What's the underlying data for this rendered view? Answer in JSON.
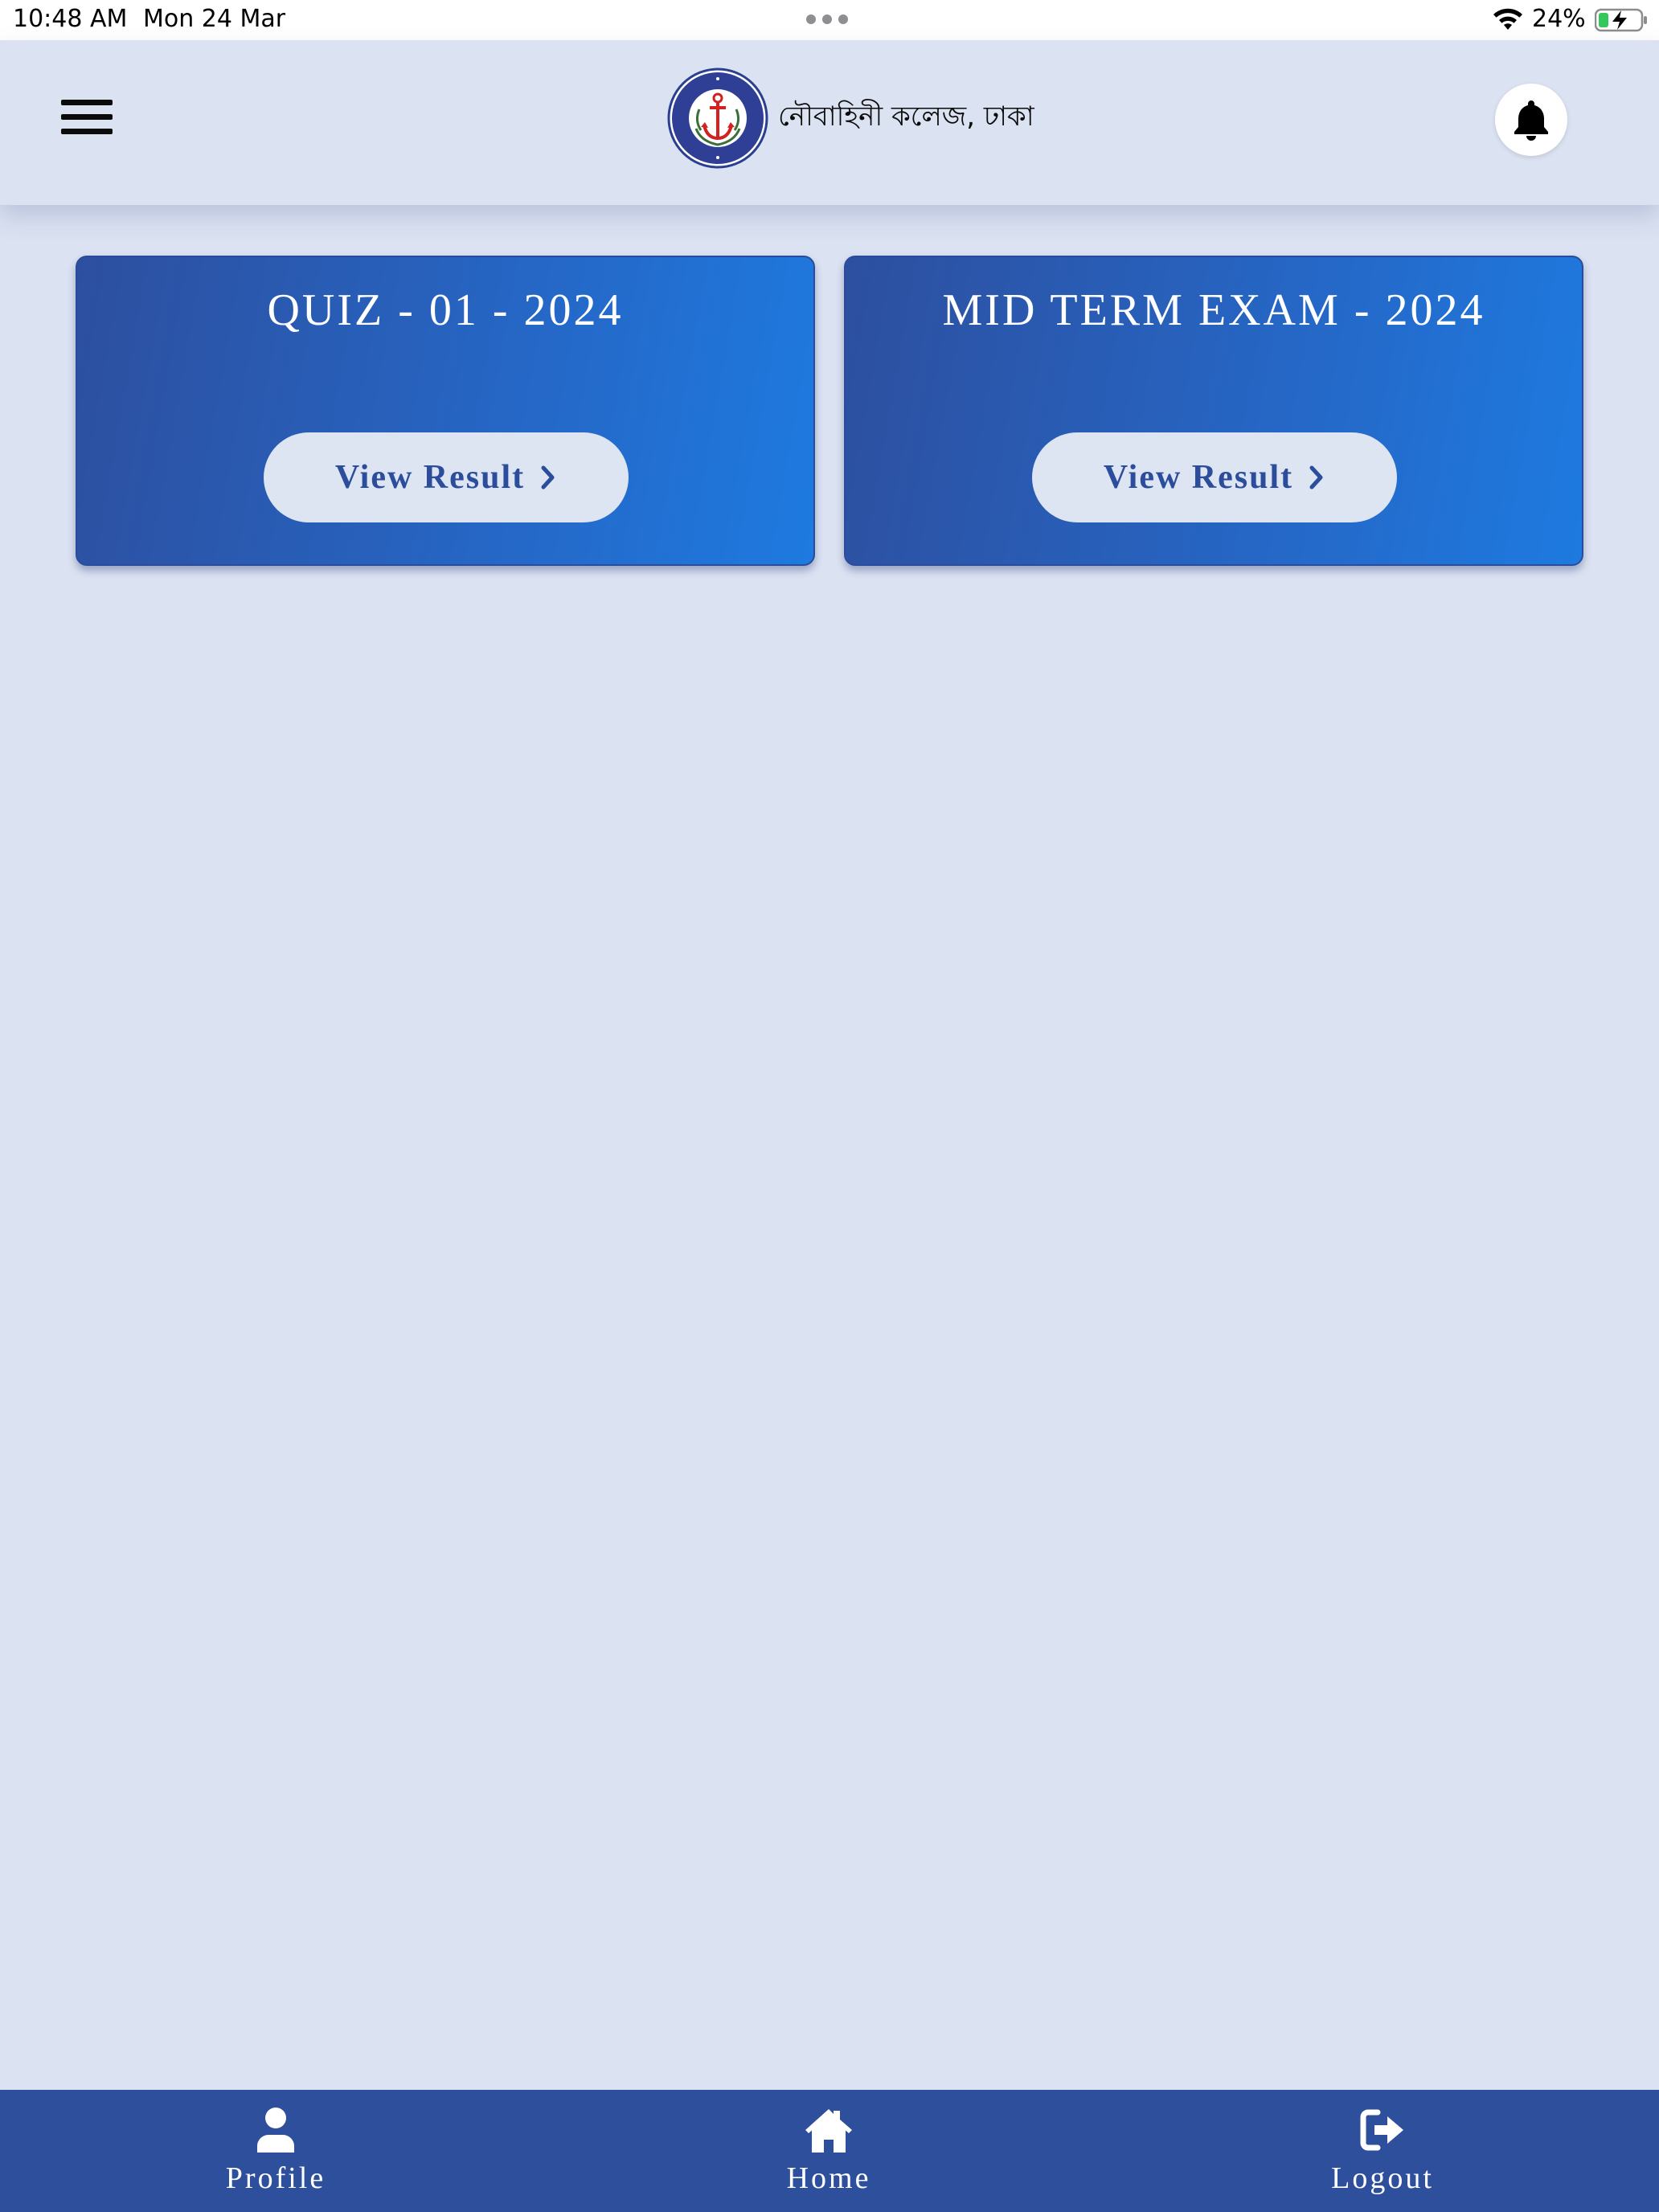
{
  "status_bar": {
    "time": "10:48 AM",
    "date": "Mon 24 Mar",
    "battery_percent": "24%",
    "battery_level": 0.24,
    "charging": true
  },
  "header": {
    "college_name": "নৌবাহিনী কলেজ, ঢাকা",
    "logo_icon": "anchor-emblem-logo",
    "menu_icon": "hamburger-menu-icon",
    "notification_icon": "bell-icon"
  },
  "cards": [
    {
      "title": "QUIZ - 01 - 2024",
      "button_label": "View Result"
    },
    {
      "title": "MID TERM EXAM - 2024",
      "button_label": "View Result"
    }
  ],
  "bottom_nav": {
    "items": [
      {
        "label": "Profile",
        "icon": "user-icon"
      },
      {
        "label": "Home",
        "icon": "home-icon"
      },
      {
        "label": "Logout",
        "icon": "logout-icon"
      }
    ]
  },
  "colors": {
    "background": "#dbe2f2",
    "card_gradient_start": "#2d4f9f",
    "card_gradient_end": "#1e7ae0",
    "button_bg": "#dde5f3",
    "button_text": "#2b4d9c",
    "nav_bg": "#2e4f9c"
  }
}
